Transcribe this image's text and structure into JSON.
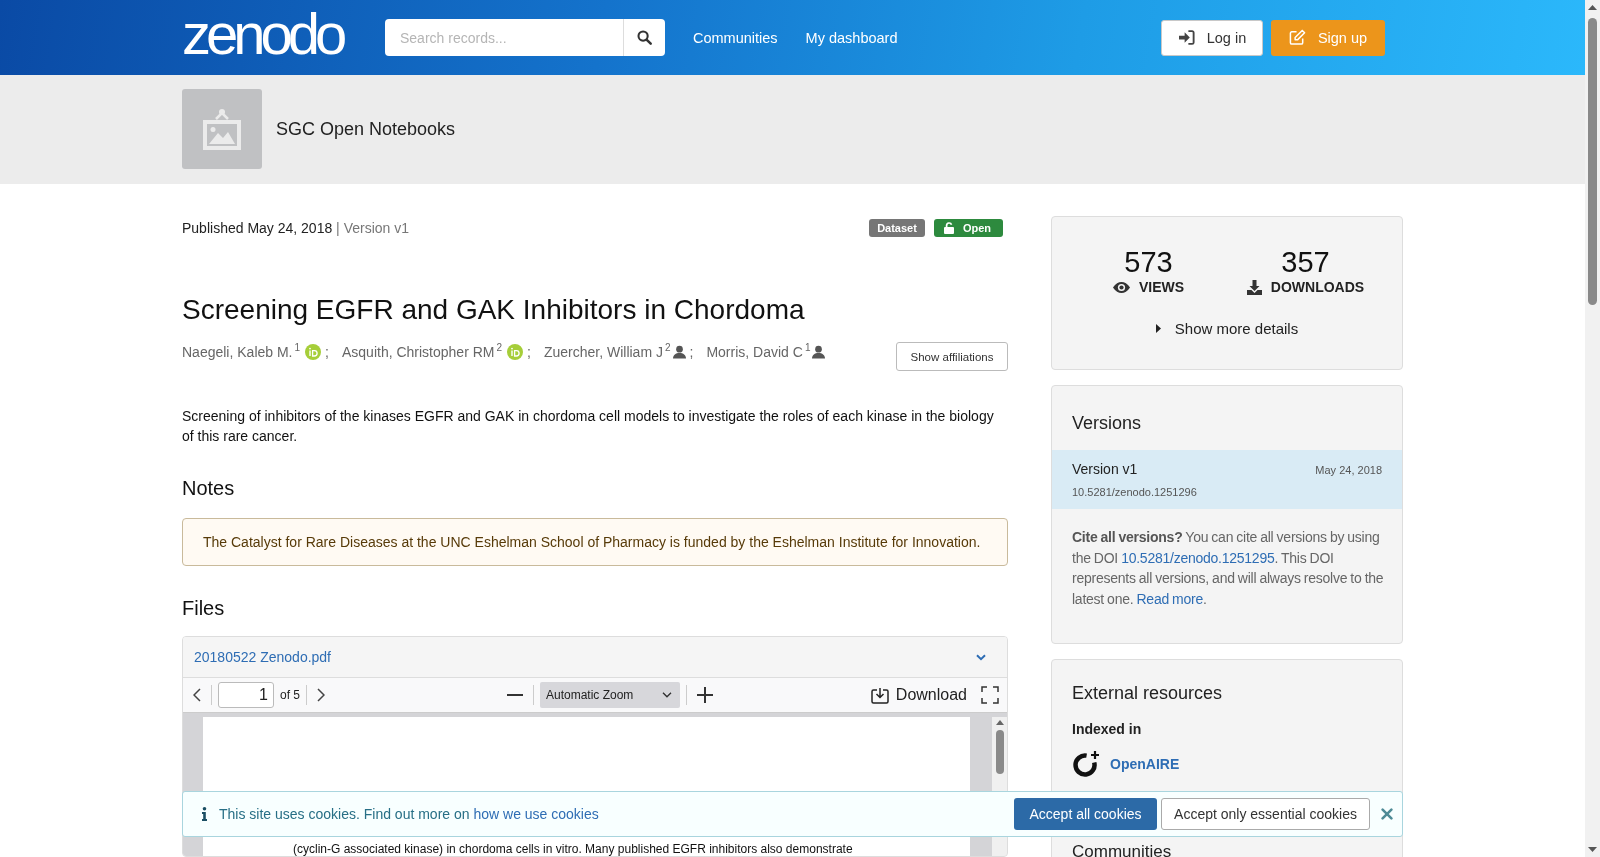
{
  "header": {
    "logo": "zenodo",
    "search": {
      "placeholder": "Search records..."
    },
    "nav": [
      "Communities",
      "My dashboard"
    ],
    "buttons": [
      {
        "label": "Log in",
        "kind": "login"
      },
      {
        "label": "Sign up",
        "kind": "signup"
      }
    ]
  },
  "community": {
    "name": "SGC Open Notebooks"
  },
  "record": {
    "published": "Published May 24, 2018",
    "separator": "|",
    "version": "Version v1",
    "badges": [
      {
        "label": "Dataset",
        "kind": "type"
      },
      {
        "label": "Open",
        "kind": "access"
      }
    ],
    "title": "Screening EGFR and GAK Inhibitors in Chordoma",
    "authors": [
      {
        "name": "Naegeli, Kaleb M.",
        "affiliation": "1",
        "kind": "orcid",
        "separator": ";"
      },
      {
        "name": "Asquith, Christopher RM",
        "affiliation": "2",
        "kind": "orcid",
        "separator": ";"
      },
      {
        "name": "Zuercher, William J",
        "affiliation": "2",
        "kind": "person",
        "separator": ";"
      },
      {
        "name": "Morris, David C",
        "affiliation": "1",
        "kind": "person"
      }
    ],
    "show_affiliations": "Show affiliations",
    "description": "Screening of inhibitors of the kinases EGFR and GAK in chordoma cell models to investigate the roles of each kinase in the biology of this rare cancer.",
    "notes": {
      "heading": "Notes",
      "text": "The Catalyst for Rare Diseases at the UNC Eshelman School of Pharmacy is funded by the Eshelman Institute for Innovation."
    },
    "files": {
      "heading": "Files",
      "file_name": "20180522 Zenodo.pdf",
      "viewer": {
        "page": "1",
        "page_count": "of 5",
        "zoom": "Automatic Zoom",
        "download": "Download",
        "page_text": "(cyclin-G associated kinase) in chordoma cells in vitro. Many published EGFR inhibitors also demonstrate"
      }
    }
  },
  "sidebar": {
    "stats": [
      {
        "value": "573",
        "label": "VIEWS",
        "kind": "views"
      },
      {
        "value": "357",
        "label": "DOWNLOADS",
        "kind": "downloads"
      }
    ],
    "show_more": "Show more details",
    "versions": {
      "heading": "Versions",
      "items": [
        {
          "title": "Version v1",
          "date": "May 24, 2018",
          "doi": "10.5281/zenodo.1251296",
          "selected": true
        }
      ],
      "cite": {
        "intro": "**Cite all versions?** You can cite all versions by using the DOI",
        "doi": "10.5281/zenodo.1251295",
        "middle": ". This DOI represents all versions, and will always resolve to the latest one.",
        "link": "Read more",
        "end": "."
      }
    },
    "external": {
      "heading": "External resources",
      "subheading": "Indexed in",
      "items": [
        "OpenAIRE"
      ]
    },
    "communities": {
      "heading": "Communities"
    }
  },
  "cookie_banner": {
    "text": "This site uses cookies. Find out more on",
    "link": "how we use cookies",
    "buttons": [
      {
        "label": "Accept all cookies",
        "kind": "primary"
      },
      {
        "label": "Accept only essential cookies",
        "kind": "secondary"
      }
    ]
  }
}
